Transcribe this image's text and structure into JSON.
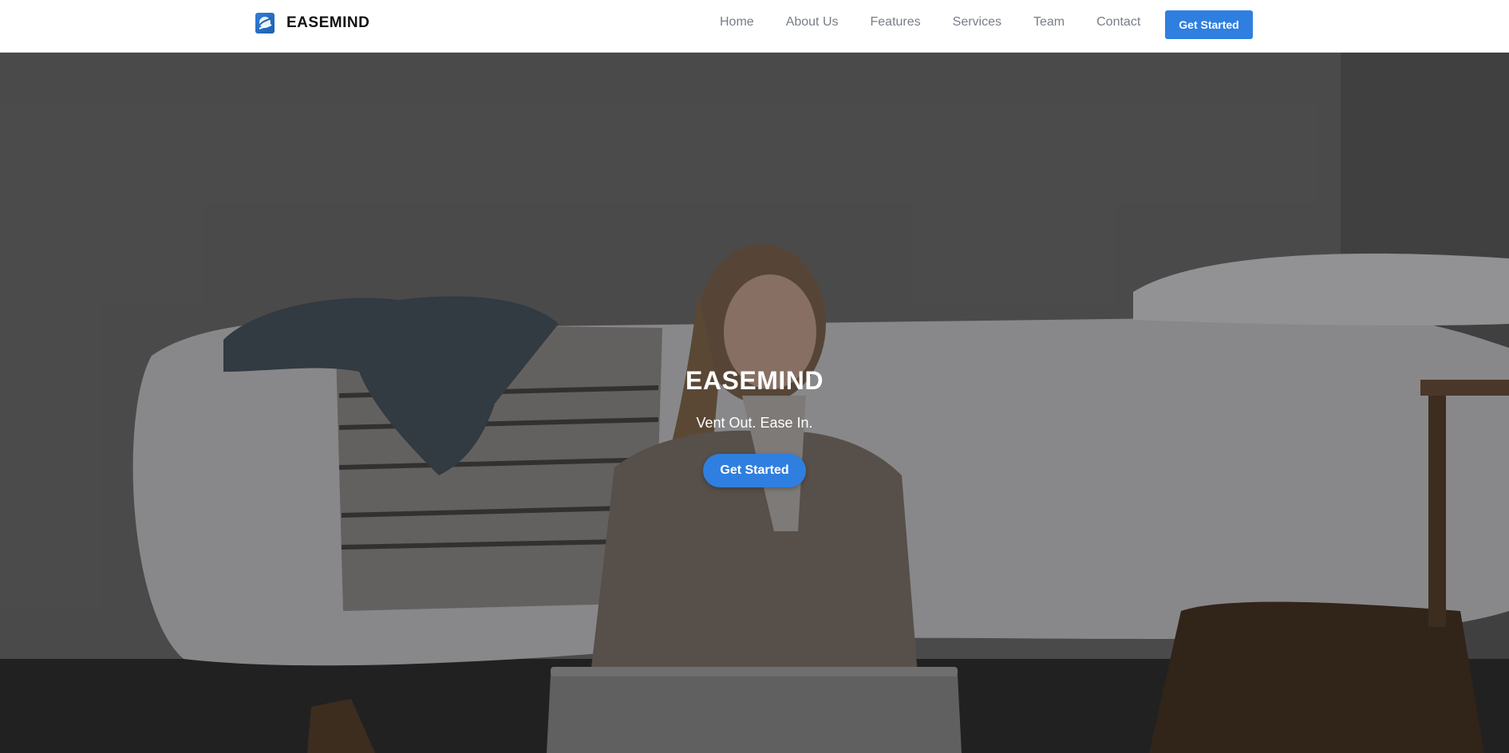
{
  "brand": {
    "name": "EASEMIND",
    "logo_icon": "brand-logo-icon"
  },
  "nav": {
    "links": [
      "Home",
      "About Us",
      "Features",
      "Services",
      "Team",
      "Contact"
    ],
    "cta_label": "Get Started"
  },
  "hero": {
    "title": "EASEMIND",
    "tagline": "Vent Out. Ease In.",
    "cta_label": "Get Started",
    "image_description_icon": "hero-photo"
  },
  "colors": {
    "accent": "#2f7fe0",
    "nav_text": "#777e88",
    "brand_text": "#111111"
  }
}
